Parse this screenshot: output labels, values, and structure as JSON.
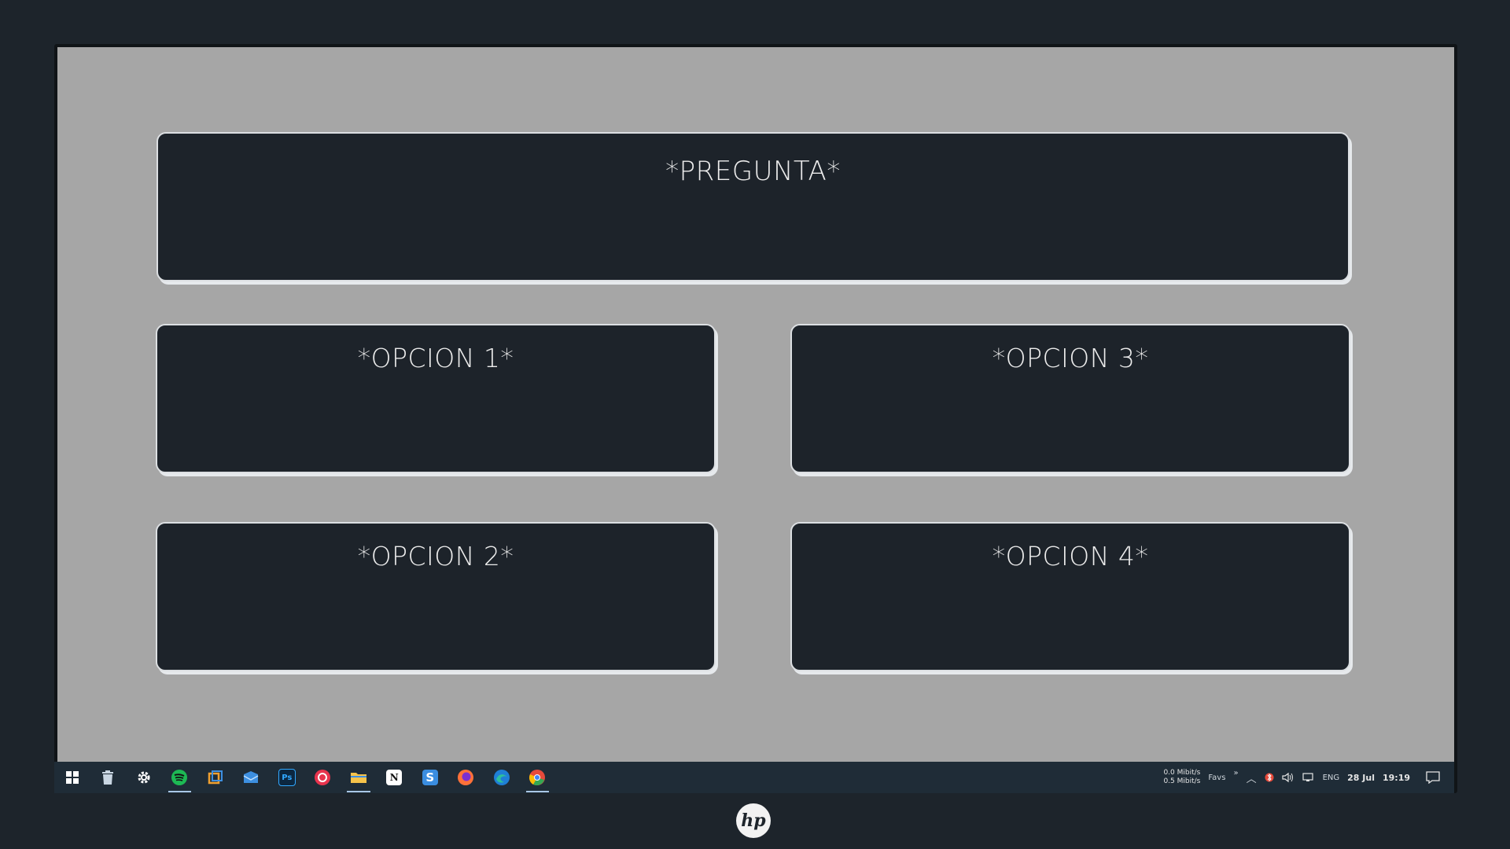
{
  "quiz": {
    "question": "*PREGUNTA*",
    "options": [
      "*OPCION 1*",
      "*OPCION 2*",
      "*OPCION 3*",
      "*OPCION 4*"
    ]
  },
  "taskbar": {
    "icons": [
      {
        "name": "windows-start-icon",
        "color": "#ffffff"
      },
      {
        "name": "recycle-bin-icon",
        "color": "#c9d6e2"
      },
      {
        "name": "settings-gear-icon",
        "color": "#ffffff"
      },
      {
        "name": "spotify-icon",
        "color": "#1db954"
      },
      {
        "name": "window-manager-icon",
        "color": "#f0a030"
      },
      {
        "name": "mail-icon",
        "color": "#3d8fe0"
      },
      {
        "name": "photoshop-icon",
        "color": "#31a8ff"
      },
      {
        "name": "creative-cloud-icon",
        "color": "#e8344e"
      },
      {
        "name": "file-explorer-icon",
        "color": "#f6c34a"
      },
      {
        "name": "notion-icon",
        "color": "#ffffff"
      },
      {
        "name": "simplenote-icon",
        "color": "#3a8de0"
      },
      {
        "name": "firefox-icon",
        "color": "#ff7139"
      },
      {
        "name": "edge-icon",
        "color": "#2fbf9b"
      },
      {
        "name": "chrome-icon",
        "color": "#e64a3b"
      }
    ],
    "tray": {
      "net_down": "0.0 Mibit/s",
      "net_up": "0.5 Mibit/s",
      "favs": "Favs",
      "language": "ENG",
      "date": "28 Jul",
      "time": "19:19"
    }
  },
  "brand": "hp"
}
